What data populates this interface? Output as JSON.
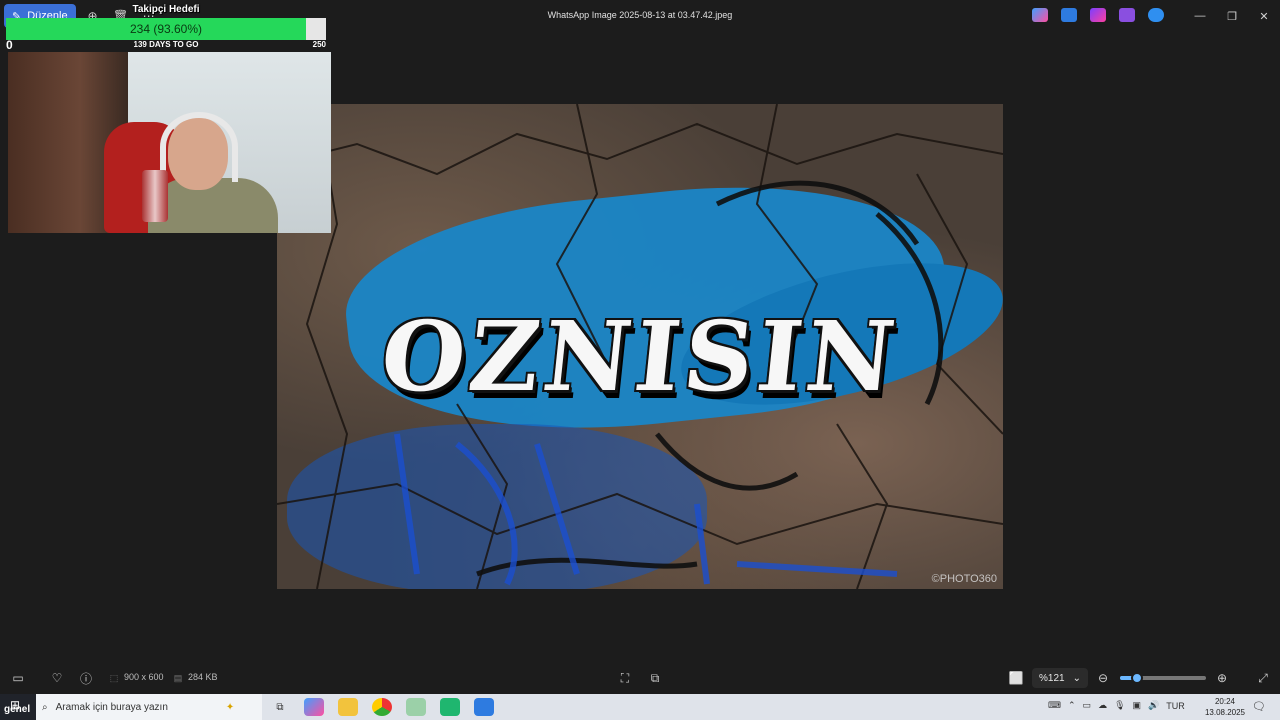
{
  "window": {
    "title": "WhatsApp Image 2025-08-13 at 03.47.42.jpeg",
    "tab_label": "Düzenle",
    "minimize": "—",
    "maximize": "❐",
    "close": "✕"
  },
  "toolbar_icons": [
    "zoom-icon",
    "delete-icon",
    "more-icon"
  ],
  "photo": {
    "graffiti_text": "OZNISIN",
    "watermark": "©PHOTO360"
  },
  "goal": {
    "title": "Takipçi Hedefi",
    "progress_text": "234 (93.60%)",
    "progress_fraction": 0.936,
    "min": "0",
    "max": "250",
    "days_text": "139 DAYS TO GO",
    "fill_color": "#25d85a"
  },
  "bottombar": {
    "dimensions": "900 x 600",
    "file_size": "284 KB",
    "zoom_value": "%121",
    "zoom_fraction": 0.2
  },
  "taskbar": {
    "label": "genel",
    "search_placeholder": "Aramak için buraya yazın",
    "language": "TUR",
    "time": "20:24",
    "date": "13.08.2025"
  }
}
